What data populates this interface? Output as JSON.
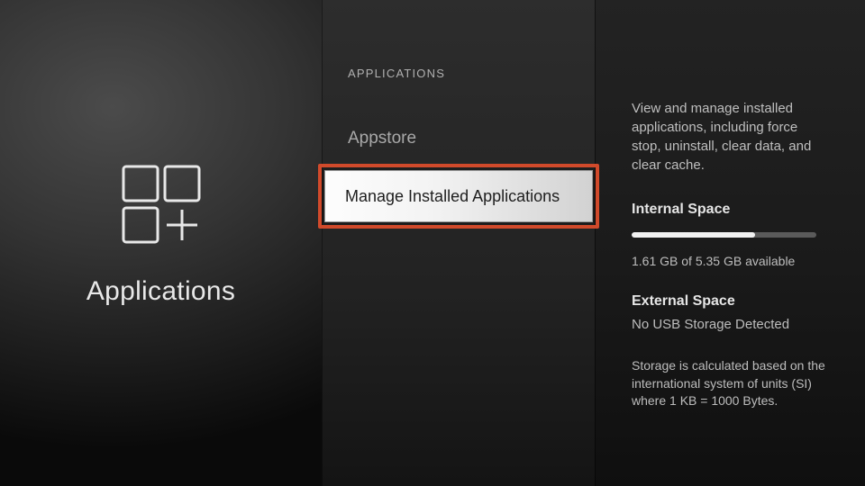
{
  "left": {
    "title": "Applications"
  },
  "middle": {
    "section_header": "APPLICATIONS",
    "items": [
      {
        "label": "Appstore"
      },
      {
        "label": "Manage Installed Applications",
        "selected": true
      }
    ]
  },
  "right": {
    "description": "View and manage installed applications, including force stop, uninstall, clear data, and clear cache.",
    "internal": {
      "heading": "Internal Space",
      "used_gb": 3.74,
      "total_gb": 5.35,
      "available_gb": 1.61,
      "available_text": "1.61 GB of 5.35 GB available",
      "fill_percent": 67
    },
    "external": {
      "heading": "External Space",
      "status": "No USB Storage Detected"
    },
    "footnote": "Storage is calculated based on the international system of units (SI) where 1 KB = 1000 Bytes."
  }
}
